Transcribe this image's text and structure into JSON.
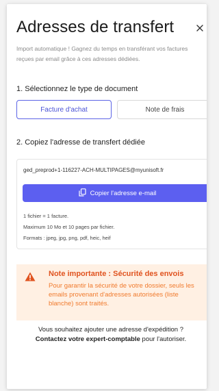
{
  "header": {
    "title": "Adresses de transfert",
    "subtitle": "Import automatique ! Gagnez du temps en transférant vos factures reçues par email grâce à ces adresses dédiées."
  },
  "step1": {
    "label": "1. Sélectionnez le type de document",
    "options": [
      {
        "label": "Facture d'achat",
        "selected": true
      },
      {
        "label": "Note de frais",
        "selected": false
      }
    ]
  },
  "step2": {
    "label": "2. Copiez l'adresse de transfert dédiée",
    "email": "ged_preprod+1-116227-ACH-MULTIPAGES@myunisoft.fr",
    "copy_button": "Copier l'adresse e-mail",
    "info": [
      "1 fichier = 1 facture.",
      "Maximum 10 Mo et 10 pages par fichier.",
      "Formats : jpeg, jpg, png, pdf, heic, heif"
    ]
  },
  "alert": {
    "title": "Note importante : Sécurité des envois",
    "body": "Pour garantir la sécurité de votre dossier, seuls les emails provenant d'adresses autorisées (liste blanche) sont traités.",
    "accent_color": "#e0531f",
    "icon": "warning-icon"
  },
  "footer": {
    "line1": "Vous souhaitez ajouter une adresse d'expédition ?",
    "link": "Contactez votre expert-comptable",
    "line2_suffix": " pour l'autoriser."
  },
  "colors": {
    "primary": "#5c5ff0",
    "alert_bg": "#fff0e3"
  }
}
